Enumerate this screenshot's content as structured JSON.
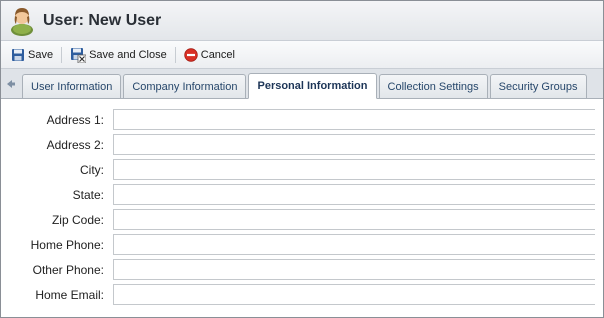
{
  "window": {
    "title": "User: New User"
  },
  "toolbar": {
    "save_label": "Save",
    "save_close_label": "Save and Close",
    "cancel_label": "Cancel"
  },
  "tabs": [
    {
      "label": "User Information",
      "active": false
    },
    {
      "label": "Company Information",
      "active": false
    },
    {
      "label": "Personal Information",
      "active": true
    },
    {
      "label": "Collection Settings",
      "active": false
    },
    {
      "label": "Security Groups",
      "active": false
    }
  ],
  "form": {
    "fields": [
      {
        "label": "Address 1:",
        "value": ""
      },
      {
        "label": "Address 2:",
        "value": ""
      },
      {
        "label": "City:",
        "value": ""
      },
      {
        "label": "State:",
        "value": ""
      },
      {
        "label": "Zip Code:",
        "value": ""
      },
      {
        "label": "Home Phone:",
        "value": ""
      },
      {
        "label": "Other Phone:",
        "value": ""
      },
      {
        "label": "Home Email:",
        "value": ""
      }
    ]
  },
  "icons": {
    "user": "user-icon",
    "save": "floppy-disk-icon",
    "save_close": "floppy-disk-close-icon",
    "cancel": "cancel-icon",
    "tab_scroll_left": "arrow-left-icon"
  },
  "colors": {
    "active_tab_text": "#1d3557",
    "tab_text": "#27476b",
    "cancel_red": "#d93025"
  }
}
